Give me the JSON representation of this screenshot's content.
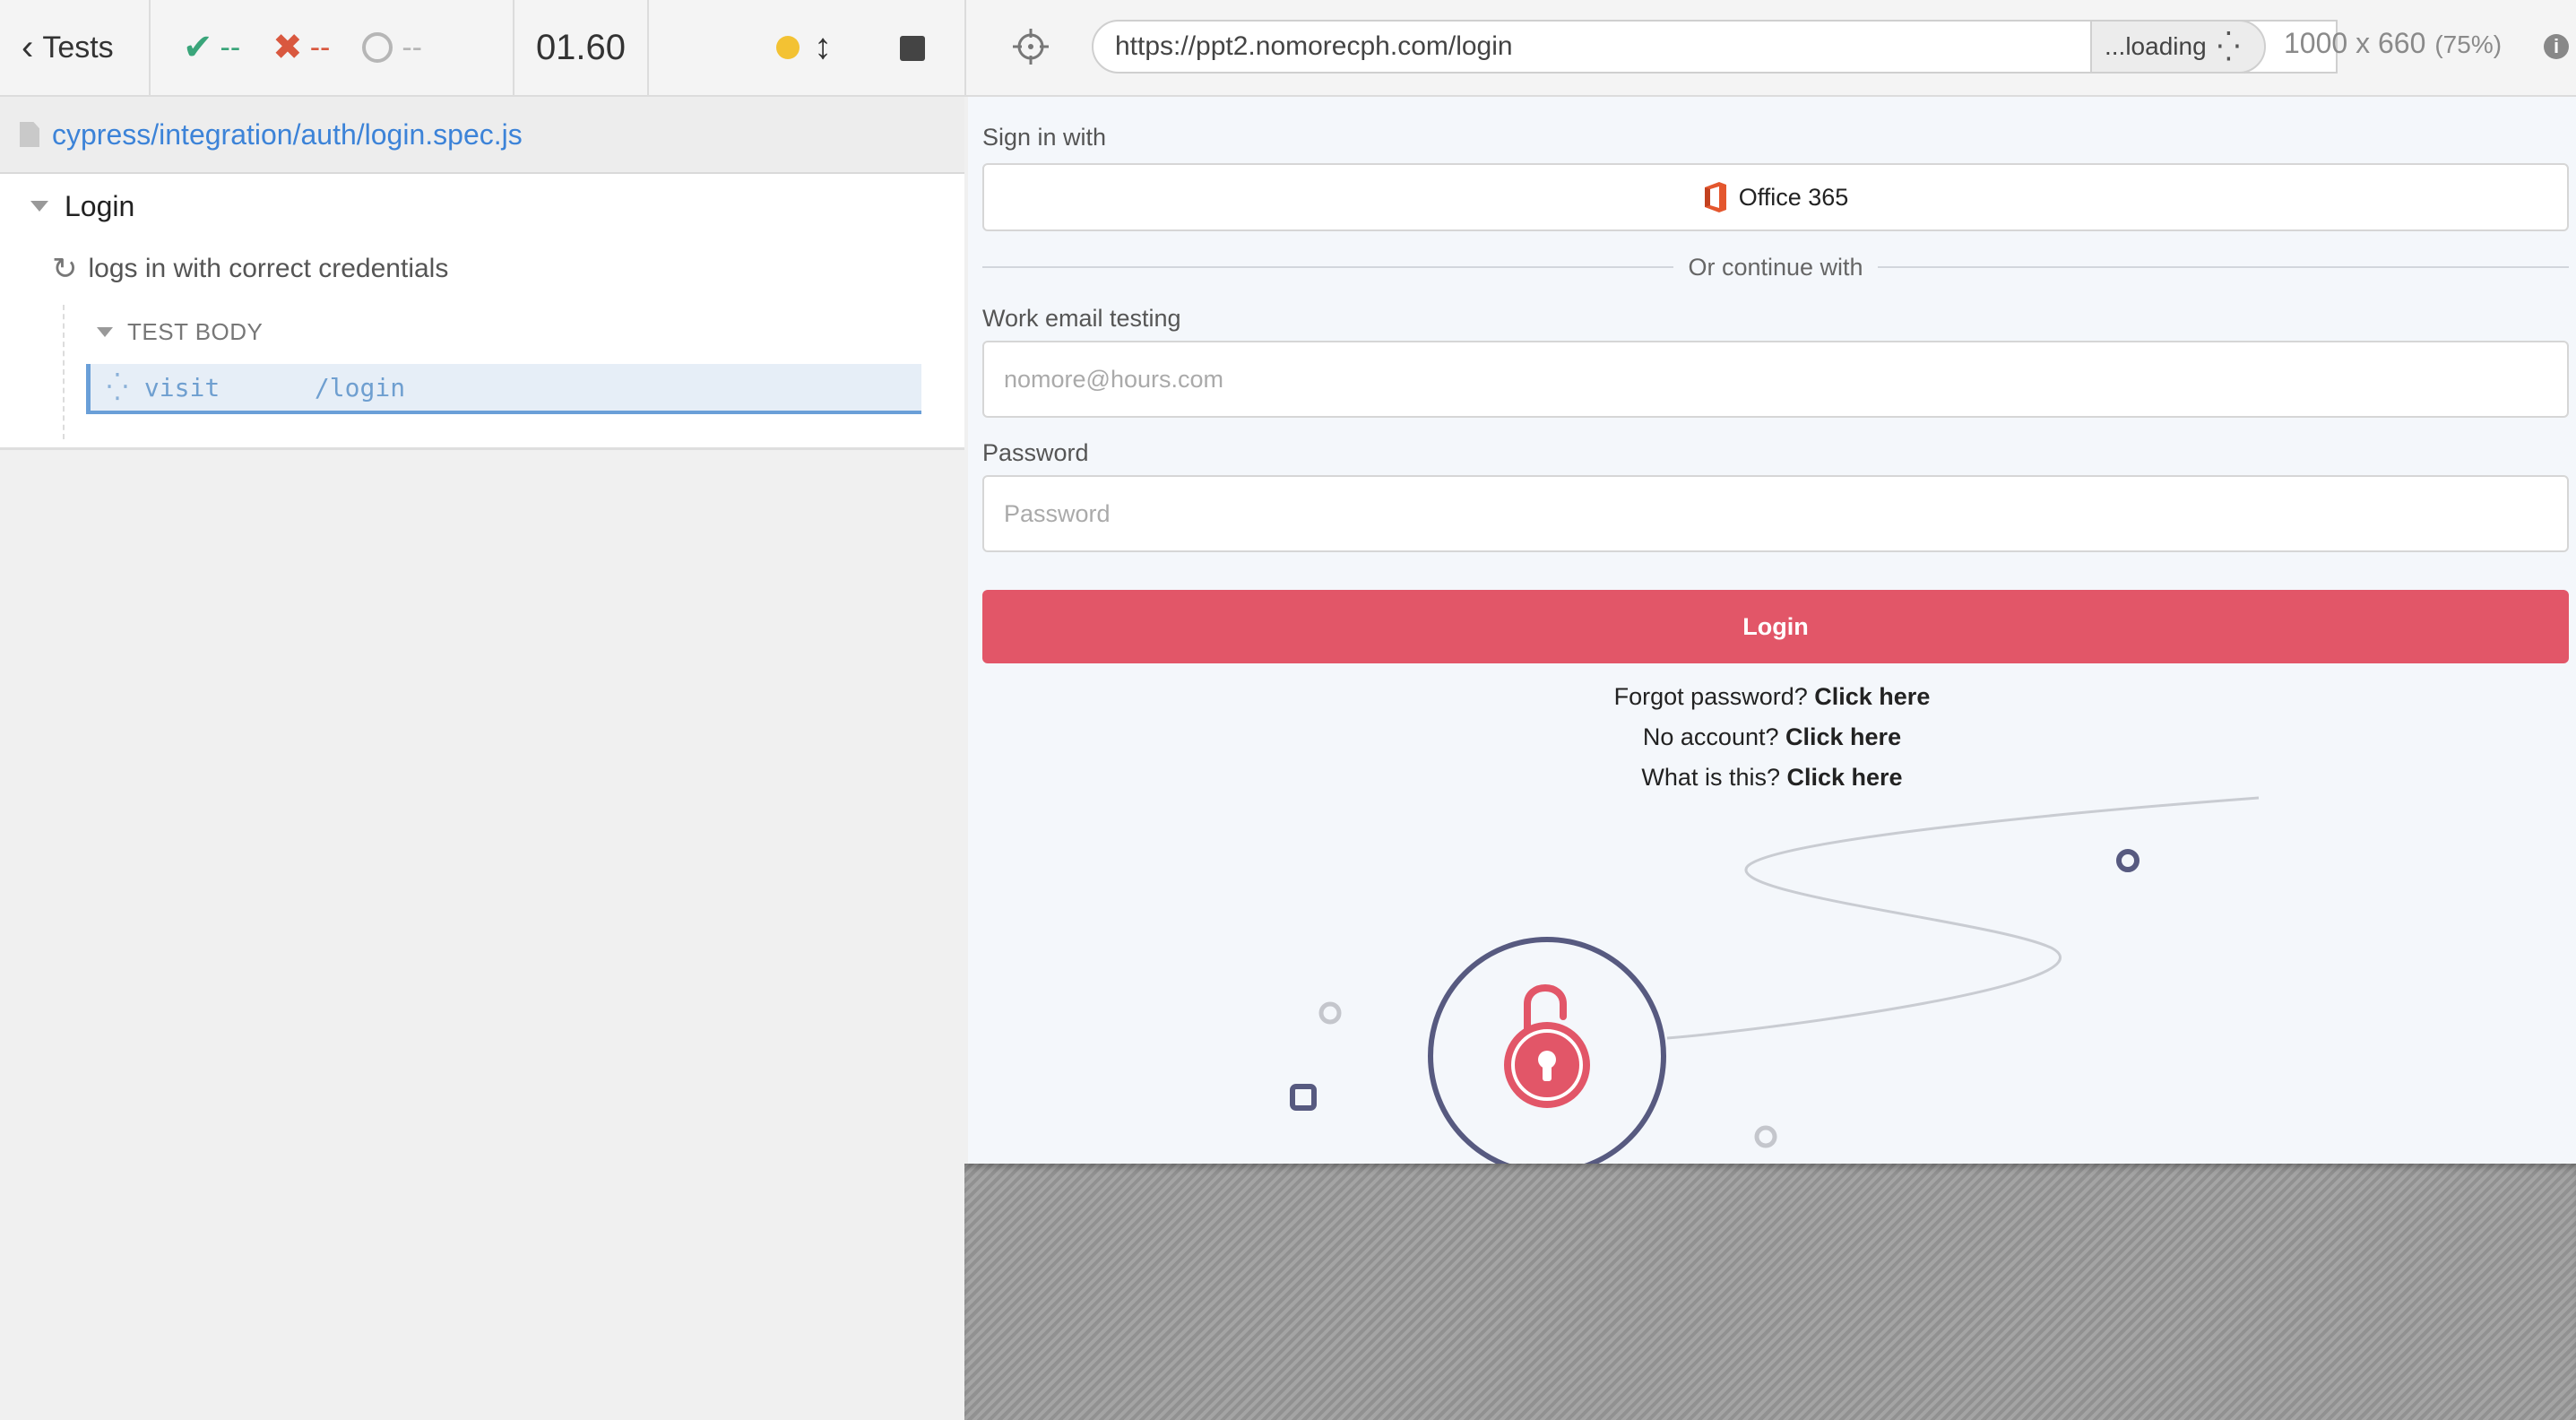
{
  "reporter": {
    "header": {
      "tests_label": "Tests",
      "passed": "--",
      "failed": "--",
      "pending": "--",
      "duration": "01.60"
    },
    "spec_path": "cypress/integration/auth/login.spec.js",
    "suite": {
      "title": "Login",
      "test": {
        "title": "logs in with correct credentials",
        "hook_title": "TEST BODY",
        "command": {
          "name": "visit",
          "message": "/login"
        }
      }
    }
  },
  "aut": {
    "url": "https://ppt2.nomorecph.com/login",
    "loading_label": "...loading",
    "viewport": "1000 x 660",
    "scale": "(75%)",
    "page": {
      "sign_in_with": "Sign in with",
      "office_button": "Office 365",
      "divider": "Or continue with",
      "email_label": "Work email testing",
      "email_placeholder": "nomore@hours.com",
      "password_label": "Password",
      "password_placeholder": "Password",
      "login_button": "Login",
      "links": [
        {
          "prefix": "Forgot password?",
          "link": "Click here"
        },
        {
          "prefix": "No account?",
          "link": "Click here"
        },
        {
          "prefix": "What is this?",
          "link": "Click here"
        }
      ]
    }
  },
  "colors": {
    "brand_red": "#e25668",
    "link_blue": "#3c83d8",
    "pass_green": "#3aa57a",
    "fail_red": "#d9583f",
    "office_orange": "#e4572e",
    "illustration_navy": "#575a80"
  },
  "icons": {
    "back": "chevron-left-icon",
    "passed": "check-icon",
    "failed": "x-icon",
    "pending": "circle-outline-icon",
    "running": "spinner-icon",
    "scroll": "vertical-arrows-icon",
    "stop": "stop-icon",
    "selector": "crosshair-icon",
    "file": "file-icon",
    "info": "info-icon",
    "office": "office-logo-icon",
    "lock": "padlock-icon"
  }
}
